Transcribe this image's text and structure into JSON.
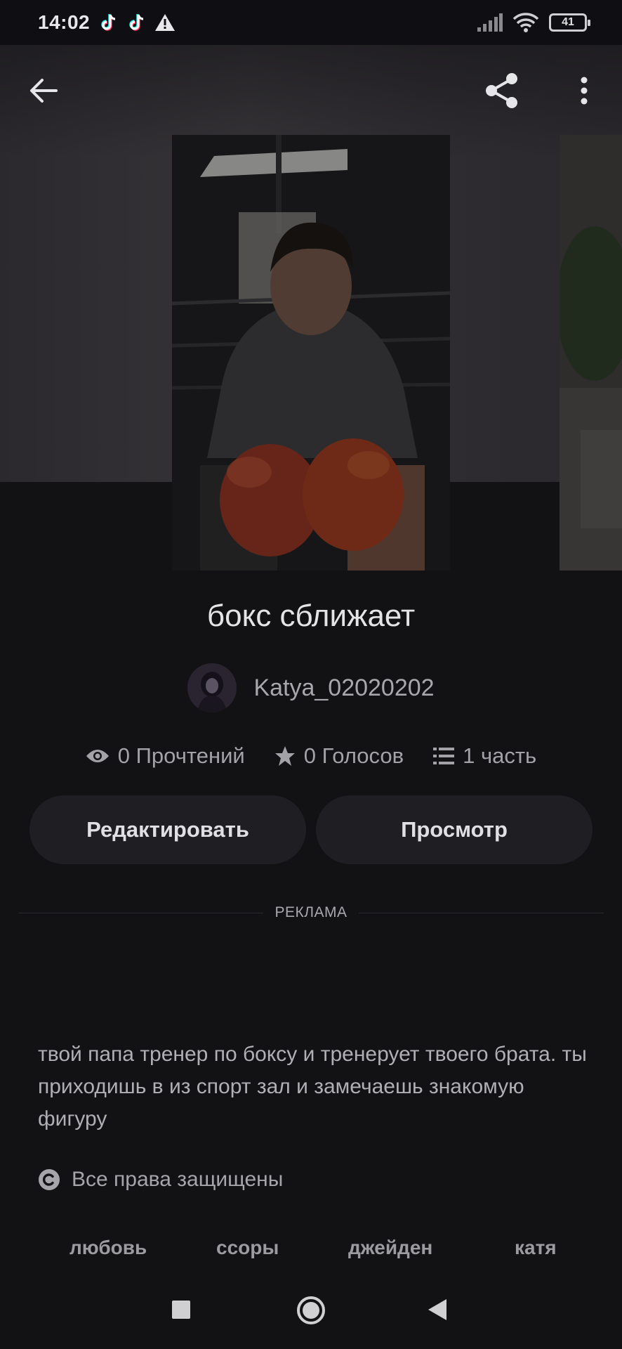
{
  "status_bar": {
    "time": "14:02",
    "battery": "41",
    "icons": [
      "tiktok-icon",
      "tiktok-icon",
      "warning-icon",
      "signal-icon",
      "wifi-icon",
      "battery-icon"
    ]
  },
  "top_nav": {
    "icons": [
      "back-arrow-icon",
      "share-icon",
      "more-vertical-icon"
    ]
  },
  "story": {
    "title": "бокс сближает",
    "author": "Katya_02020202",
    "stats": {
      "reads": "0 Прочтений",
      "votes": "0 Голосов",
      "parts": "1 часть"
    },
    "description": "твой папа тренер по боксу и тренерует твоего брата. ты приходишь в из спорт зал и замечаешь знакомую фигуру",
    "copyright": "Все права защищены"
  },
  "actions": {
    "edit": "Редактировать",
    "view": "Просмотр"
  },
  "ad": {
    "label": "РЕКЛАМА"
  },
  "tags": [
    "любовь",
    "ссоры",
    "джейден",
    "катя"
  ],
  "nav_bar": {
    "icons": [
      "recents-square-icon",
      "home-circle-icon",
      "back-triangle-icon"
    ]
  },
  "colors": {
    "background": "#121114",
    "button_bg": "#1f1e22",
    "text_primary": "#e4e4e6",
    "text_secondary": "#a8a7ab"
  }
}
